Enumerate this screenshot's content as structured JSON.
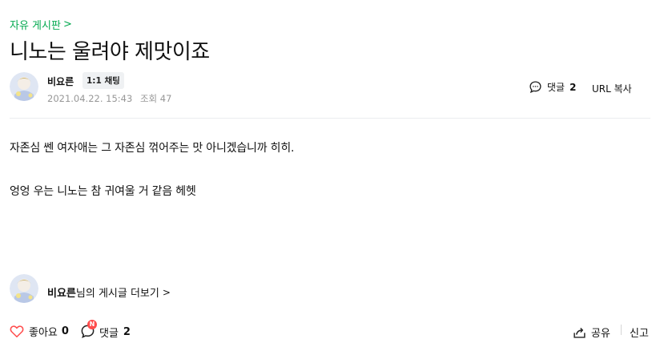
{
  "board": {
    "name": "자유 게시판"
  },
  "post": {
    "title": "니노는 울려야 제맛이죠",
    "author": "비요른",
    "chat_label": "1:1 채팅",
    "date": "2021.04.22. 15:43",
    "views_label": "조회 47",
    "comments_label": "댓글",
    "comments_count": "2",
    "copy_url_label": "URL 복사",
    "paragraphs": [
      "자존심 쎈 여자애는 그 자존심 꺾어주는 맛 아니겠습니까 히히.",
      "엉엉 우는 니노는 참 귀여울 거 같음 헤헷"
    ]
  },
  "footer": {
    "author_name": "비요른",
    "more_suffix": "님의 게시글 더보기",
    "like_label": "좋아요",
    "like_count": "0",
    "comment_label": "댓글",
    "comment_count": "2",
    "new_badge": "N",
    "share_label": "공유",
    "report_label": "신고"
  },
  "colors": {
    "accent_green": "#03a94f",
    "heart_red": "#ff4d4d",
    "meta_gray": "#979797"
  },
  "icons": {
    "board_chevron": "chevron-right-icon",
    "comment": "speech-bubble-icon",
    "like": "heart-icon",
    "share": "share-icon"
  }
}
